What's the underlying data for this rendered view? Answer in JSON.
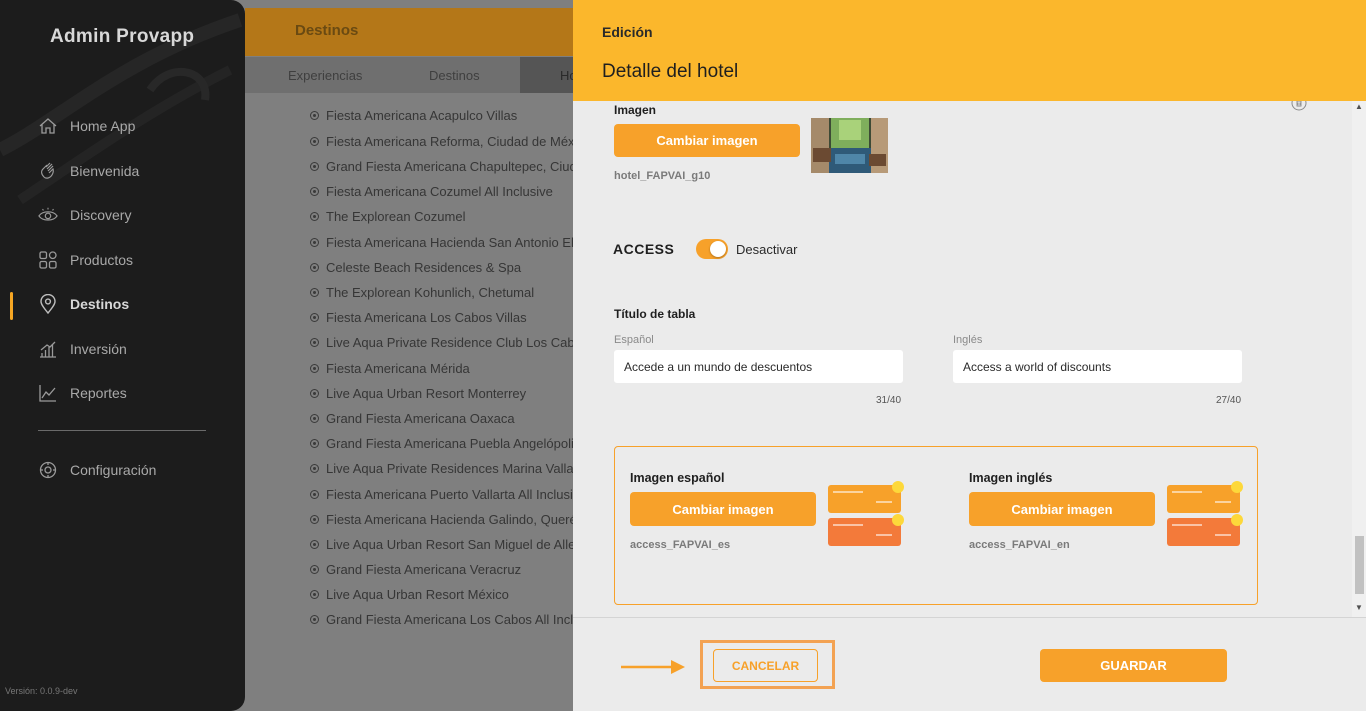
{
  "sidebar": {
    "brand": "Admin Provapp",
    "items": [
      {
        "label": "Home App",
        "icon": "home-icon"
      },
      {
        "label": "Bienvenida",
        "icon": "wave-hand-icon"
      },
      {
        "label": "Discovery",
        "icon": "eye-icon"
      },
      {
        "label": "Productos",
        "icon": "grid-icon"
      },
      {
        "label": "Destinos",
        "icon": "location-pin-icon",
        "active": true
      },
      {
        "label": "Inversión",
        "icon": "bar-chart-icon"
      },
      {
        "label": "Reportes",
        "icon": "line-chart-icon"
      },
      {
        "label": "Configuración",
        "icon": "gear-icon"
      }
    ],
    "version": "Versión: 0.0.9-dev"
  },
  "main": {
    "title": "Destinos",
    "tabs": [
      "Experiencias",
      "Destinos",
      "Ho"
    ],
    "hotels": [
      "Fiesta Americana Acapulco Villas",
      "Fiesta Americana Reforma, Ciudad de México",
      "Grand Fiesta Americana Chapultepec, Ciudad de México",
      "Fiesta Americana Cozumel All Inclusive",
      "The Explorean Cozumel",
      "Fiesta Americana Hacienda San Antonio El Puente",
      "Celeste Beach Residences & Spa",
      "The Explorean Kohunlich, Chetumal",
      "Fiesta Americana Los Cabos Villas",
      "Live Aqua Private Residence Club Los Cabos",
      "Fiesta Americana Mérida",
      "Live Aqua Urban Resort Monterrey",
      "Grand Fiesta Americana Oaxaca",
      "Grand Fiesta Americana Puebla Angelópolis",
      "Live Aqua Private Residences Marina Vallarta",
      "Fiesta Americana Puerto Vallarta All Inclusive",
      "Fiesta Americana Hacienda Galindo, Querétaro",
      "Live Aqua Urban Resort San Miguel de Allende",
      "Grand Fiesta Americana Veracruz",
      "Live Aqua Urban Resort México",
      "Grand Fiesta Americana Los Cabos All Inclusive"
    ]
  },
  "drawer": {
    "subtitle": "Edición",
    "title": "Detalle del hotel",
    "image": {
      "label": "Imagen",
      "button": "Cambiar imagen",
      "filename": "hotel_FAPVAI_g10"
    },
    "access": {
      "label": "ACCESS",
      "toggle_on": true,
      "toggle_text": "Desactivar"
    },
    "table_title": {
      "label": "Título de tabla",
      "es_label": "Español",
      "es_value": "Accede a un mundo de descuentos",
      "es_counter": "31/40",
      "en_label": "Inglés",
      "en_value": "Access a world of discounts",
      "en_counter": "27/40"
    },
    "access_images": {
      "es_label": "Imagen español",
      "es_button": "Cambiar imagen",
      "es_filename": "access_FAPVAI_es",
      "en_label": "Imagen inglés",
      "en_button": "Cambiar imagen",
      "en_filename": "access_FAPVAI_en"
    },
    "footer": {
      "cancel": "CANCELAR",
      "save": "GUARDAR"
    }
  },
  "colors": {
    "accent": "#f7a12a",
    "header": "#fbb72c",
    "sidebar": "#1c1c1c"
  }
}
